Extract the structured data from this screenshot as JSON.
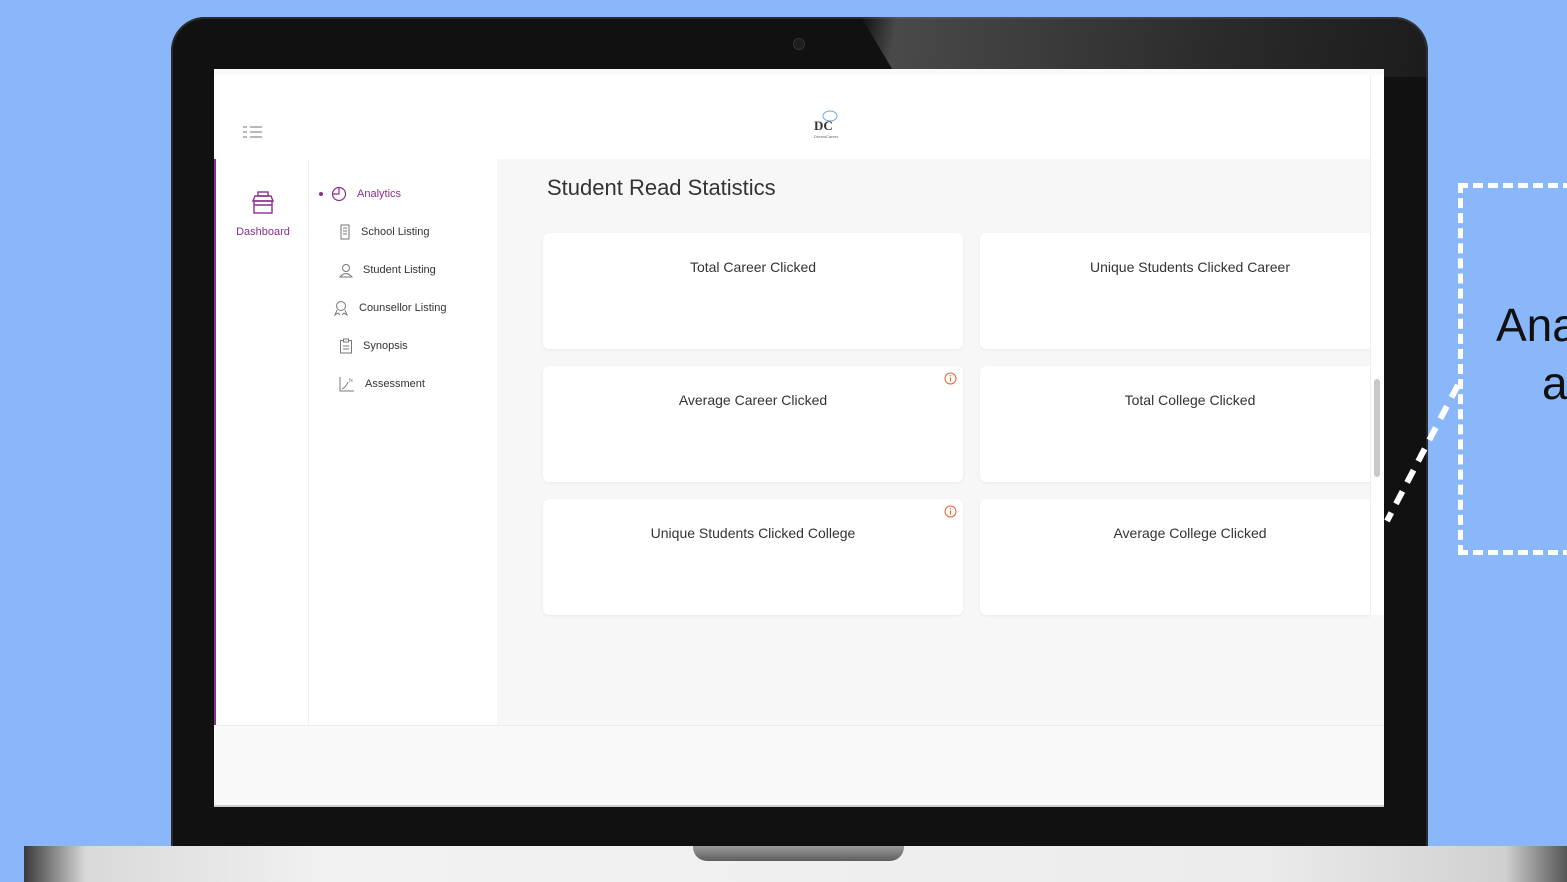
{
  "header": {
    "logo_text": "DC",
    "logo_caption": "DreamCareer"
  },
  "rail": {
    "dashboard_label": "Dashboard"
  },
  "submenu": {
    "items": [
      {
        "label": "Analytics",
        "icon": "pie-chart-icon",
        "active": true
      },
      {
        "label": "School Listing",
        "icon": "building-icon",
        "active": false
      },
      {
        "label": "Student Listing",
        "icon": "student-icon",
        "active": false
      },
      {
        "label": "Counsellor Listing",
        "icon": "counsellor-icon",
        "active": false
      },
      {
        "label": "Synopsis",
        "icon": "clipboard-icon",
        "active": false
      },
      {
        "label": "Assessment",
        "icon": "graph-icon",
        "active": false
      }
    ]
  },
  "main": {
    "title": "Student Read Statistics",
    "cards": [
      {
        "title": "Total Career Clicked",
        "info": false
      },
      {
        "title": "Unique Students Clicked Career",
        "info": false
      },
      {
        "title": "Average Career Clicked",
        "info": true
      },
      {
        "title": "Total College Clicked",
        "info": false
      },
      {
        "title": "Unique Students Clicked College",
        "info": true
      },
      {
        "title": "Average College Clicked",
        "info": false
      }
    ]
  },
  "callout": {
    "line1": "Ana",
    "line2": "a"
  },
  "colors": {
    "background": "#8ab6fa",
    "accent": "#8a2f8c",
    "info": "#e8602c"
  }
}
